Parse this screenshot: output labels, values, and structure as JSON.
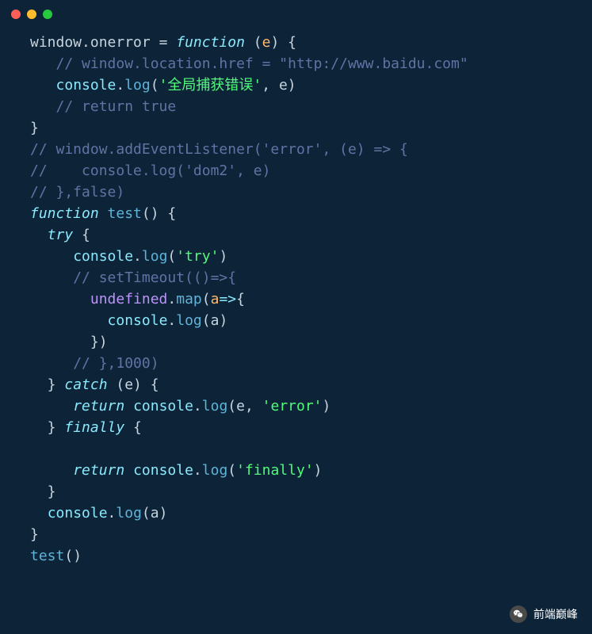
{
  "titlebar": {
    "dots": [
      "red",
      "yellow",
      "green"
    ]
  },
  "code": {
    "lines": [
      [
        {
          "t": "window",
          "c": "tk-default"
        },
        {
          "t": ".",
          "c": "tk-punct"
        },
        {
          "t": "onerror",
          "c": "tk-prop"
        },
        {
          "t": " = ",
          "c": "tk-punct"
        },
        {
          "t": "function",
          "c": "tk-keyword"
        },
        {
          "t": " (",
          "c": "tk-punct"
        },
        {
          "t": "e",
          "c": "tk-param"
        },
        {
          "t": ") {",
          "c": "tk-punct"
        }
      ],
      [
        {
          "t": "   ",
          "c": "tk-default"
        },
        {
          "t": "// window.location.href = \"http://www.baidu.com\"",
          "c": "tk-comment"
        }
      ],
      [
        {
          "t": "   ",
          "c": "tk-default"
        },
        {
          "t": "console",
          "c": "tk-builtin"
        },
        {
          "t": ".",
          "c": "tk-punct"
        },
        {
          "t": "log",
          "c": "tk-func"
        },
        {
          "t": "(",
          "c": "tk-punct"
        },
        {
          "t": "'全局捕获错误'",
          "c": "tk-string"
        },
        {
          "t": ", e)",
          "c": "tk-punct"
        }
      ],
      [
        {
          "t": "   ",
          "c": "tk-default"
        },
        {
          "t": "// return true",
          "c": "tk-comment"
        }
      ],
      [
        {
          "t": "}",
          "c": "tk-punct"
        }
      ],
      [
        {
          "t": "// window.addEventListener('error', (e) => {",
          "c": "tk-comment"
        }
      ],
      [
        {
          "t": "//    console.log('dom2', e)",
          "c": "tk-comment"
        }
      ],
      [
        {
          "t": "// },false)",
          "c": "tk-comment"
        }
      ],
      [
        {
          "t": "function",
          "c": "tk-keyword"
        },
        {
          "t": " ",
          "c": "tk-default"
        },
        {
          "t": "test",
          "c": "tk-func"
        },
        {
          "t": "() {",
          "c": "tk-punct"
        }
      ],
      [
        {
          "t": "  ",
          "c": "tk-default"
        },
        {
          "t": "try",
          "c": "tk-keyword"
        },
        {
          "t": " {",
          "c": "tk-punct"
        }
      ],
      [
        {
          "t": "     ",
          "c": "tk-default"
        },
        {
          "t": "console",
          "c": "tk-builtin"
        },
        {
          "t": ".",
          "c": "tk-punct"
        },
        {
          "t": "log",
          "c": "tk-func"
        },
        {
          "t": "(",
          "c": "tk-punct"
        },
        {
          "t": "'try'",
          "c": "tk-string"
        },
        {
          "t": ")",
          "c": "tk-punct"
        }
      ],
      [
        {
          "t": "     ",
          "c": "tk-default"
        },
        {
          "t": "// setTimeout(()=>{",
          "c": "tk-comment"
        }
      ],
      [
        {
          "t": "       ",
          "c": "tk-default"
        },
        {
          "t": "undefined",
          "c": "tk-undefined"
        },
        {
          "t": ".",
          "c": "tk-punct"
        },
        {
          "t": "map",
          "c": "tk-func"
        },
        {
          "t": "(",
          "c": "tk-punct"
        },
        {
          "t": "a",
          "c": "tk-param"
        },
        {
          "t": "=>",
          "c": "tk-keyword"
        },
        {
          "t": "{",
          "c": "tk-punct"
        }
      ],
      [
        {
          "t": "         ",
          "c": "tk-default"
        },
        {
          "t": "console",
          "c": "tk-builtin"
        },
        {
          "t": ".",
          "c": "tk-punct"
        },
        {
          "t": "log",
          "c": "tk-func"
        },
        {
          "t": "(a)",
          "c": "tk-punct"
        }
      ],
      [
        {
          "t": "       })",
          "c": "tk-punct"
        }
      ],
      [
        {
          "t": "     ",
          "c": "tk-default"
        },
        {
          "t": "// },1000)",
          "c": "tk-comment"
        }
      ],
      [
        {
          "t": "  } ",
          "c": "tk-punct"
        },
        {
          "t": "catch",
          "c": "tk-keyword"
        },
        {
          "t": " (e) {",
          "c": "tk-punct"
        }
      ],
      [
        {
          "t": "     ",
          "c": "tk-default"
        },
        {
          "t": "return",
          "c": "tk-keyword"
        },
        {
          "t": " ",
          "c": "tk-default"
        },
        {
          "t": "console",
          "c": "tk-builtin"
        },
        {
          "t": ".",
          "c": "tk-punct"
        },
        {
          "t": "log",
          "c": "tk-func"
        },
        {
          "t": "(e, ",
          "c": "tk-punct"
        },
        {
          "t": "'error'",
          "c": "tk-string"
        },
        {
          "t": ")",
          "c": "tk-punct"
        }
      ],
      [
        {
          "t": "  } ",
          "c": "tk-punct"
        },
        {
          "t": "finally",
          "c": "tk-keyword"
        },
        {
          "t": " {",
          "c": "tk-punct"
        }
      ],
      [
        {
          "t": "",
          "c": "tk-default"
        }
      ],
      [
        {
          "t": "     ",
          "c": "tk-default"
        },
        {
          "t": "return",
          "c": "tk-keyword"
        },
        {
          "t": " ",
          "c": "tk-default"
        },
        {
          "t": "console",
          "c": "tk-builtin"
        },
        {
          "t": ".",
          "c": "tk-punct"
        },
        {
          "t": "log",
          "c": "tk-func"
        },
        {
          "t": "(",
          "c": "tk-punct"
        },
        {
          "t": "'finally'",
          "c": "tk-string"
        },
        {
          "t": ")",
          "c": "tk-punct"
        }
      ],
      [
        {
          "t": "  }",
          "c": "tk-punct"
        }
      ],
      [
        {
          "t": "  ",
          "c": "tk-default"
        },
        {
          "t": "console",
          "c": "tk-builtin"
        },
        {
          "t": ".",
          "c": "tk-punct"
        },
        {
          "t": "log",
          "c": "tk-func"
        },
        {
          "t": "(a)",
          "c": "tk-punct"
        }
      ],
      [
        {
          "t": "}",
          "c": "tk-punct"
        }
      ],
      [
        {
          "t": "test",
          "c": "tk-func"
        },
        {
          "t": "()",
          "c": "tk-punct"
        }
      ]
    ]
  },
  "watermark": {
    "label": "前端巅峰"
  }
}
